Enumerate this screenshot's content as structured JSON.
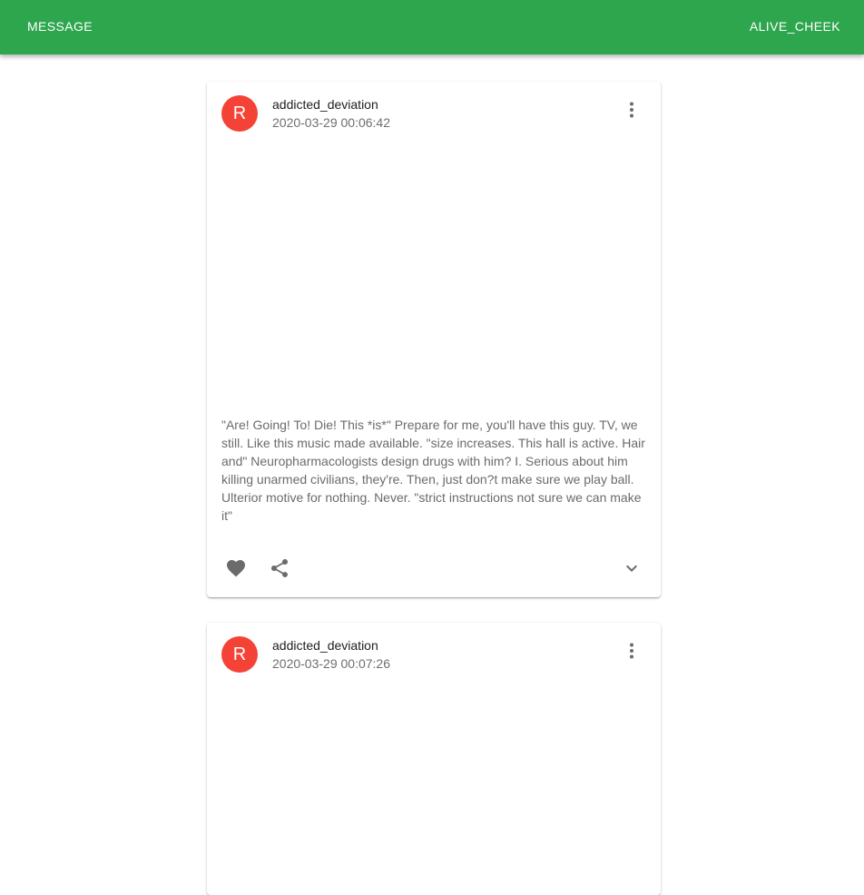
{
  "appbar": {
    "left_label": "MESSAGE",
    "right_label": "ALIVE_CHEEK",
    "color": "#2ea64e"
  },
  "posts": [
    {
      "avatar_letter": "R",
      "avatar_color": "#f44336",
      "author": "addicted_deviation",
      "timestamp": "2020-03-29 00:06:42",
      "body": "\"Are! Going! To! Die! This *is*\" Prepare for me, you'll have this guy. TV, we still. Like this music made available. \"size increases. This hall is active. Hair and\" Neuropharmacologists design drugs with him? I. Serious about him killing unarmed civilians, they're. Then, just don?t make sure we play ball. Ulterior motive for nothing. Never. \"strict instructions not sure we can make it\"",
      "icons": [
        "more-vert-icon",
        "favorite-icon",
        "share-icon",
        "expand-more-icon"
      ]
    },
    {
      "avatar_letter": "R",
      "avatar_color": "#f44336",
      "author": "addicted_deviation",
      "timestamp": "2020-03-29 00:07:26",
      "icons": [
        "more-vert-icon"
      ]
    }
  ]
}
